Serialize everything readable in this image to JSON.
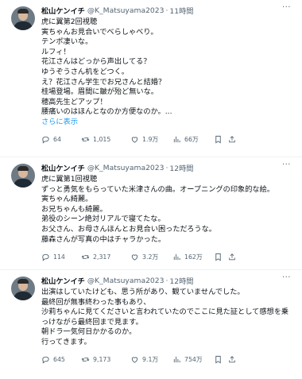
{
  "tweets": [
    {
      "name": "松山ケンイチ",
      "handle": "@K_Matsuyama2023",
      "time": "11時間",
      "lines": [
        "虎に翼第2回視聴",
        "寅ちゃんお見合いでべらしゃべり。",
        "テンポ凄いな。",
        "ルフィ！",
        "花江さんはどっから声出してる？",
        "ゆうぞうさん机をどつく。",
        "え？花江さん学生でお兄さんと結婚？",
        "桂場登場。眉間に皺が殆ど無いな。",
        "穂高先生どアップ！",
        "腰痛いのはほんとなのか方便なのか。..."
      ],
      "show_more": "さらに表示",
      "replies": "64",
      "retweets": "1,015",
      "likes": "1.9万",
      "views": "66万"
    },
    {
      "name": "松山ケンイチ",
      "handle": "@K_Matsuyama2023",
      "time": "12時間",
      "lines": [
        "虎に翼第1回視聴",
        "ずっと勇気をもらっていた米津さんの曲。オープニングの印象的な絵。",
        "寅ちゃん綺麗。",
        "お兄ちゃんも綺麗。",
        "弟役のシーン絶対リアルで寝てたな。",
        "お父さん、お母さんほんとお見合い困っただろうな。",
        "藤森さんが写真の中はチャラかった。"
      ],
      "show_more": "",
      "replies": "114",
      "retweets": "2,317",
      "likes": "3.2万",
      "views": "162万"
    },
    {
      "name": "松山ケンイチ",
      "handle": "@K_Matsuyama2023",
      "time": "12時間",
      "lines": [
        "出演はしていたけども、思う所があり、観ていませんでした。",
        "最終回が無事終わった事もあり、",
        "沙莉ちゃんに見てくださいと言われていたのでここに見た証として感想を乗",
        "っけながら最終回まで見ます。",
        "朝ドラ一気何日かかるのか。",
        "行ってきます。"
      ],
      "show_more": "",
      "replies": "645",
      "retweets": "9,173",
      "likes": "9.1万",
      "views": "754万"
    }
  ],
  "icons": {
    "more": "more-icon",
    "reply": "reply-icon",
    "retweet": "retweet-icon",
    "like": "heart-icon",
    "views": "views-icon",
    "bookmark": "bookmark-icon",
    "share": "share-icon"
  },
  "colors": {
    "link": "#1d9bf0",
    "secondary": "#536471",
    "divider": "#eff3f4"
  }
}
